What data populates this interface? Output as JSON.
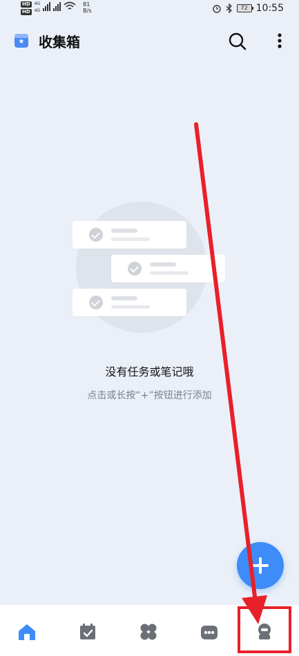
{
  "status_bar": {
    "hd1": "HD",
    "hd2": "HD",
    "net1": "4G",
    "net2": "4G",
    "speed_value": "81",
    "speed_unit": "B/s",
    "battery": "72",
    "time": "10:55"
  },
  "header": {
    "title": "收集箱",
    "title_icon": "inbox-star-icon",
    "search_icon": "search-icon",
    "more_icon": "more-vertical-icon"
  },
  "empty_state": {
    "title": "没有任务或笔记哦",
    "hint": "点击或长按“+”按钮进行添加"
  },
  "fab": {
    "icon": "plus-icon"
  },
  "bottom_nav": {
    "items": [
      {
        "icon": "home-icon",
        "active": true
      },
      {
        "icon": "calendar-check-icon",
        "active": false
      },
      {
        "icon": "grid-clover-icon",
        "active": false
      },
      {
        "icon": "robot-icon",
        "active": false
      },
      {
        "icon": "profile-icon",
        "active": false
      }
    ]
  },
  "colors": {
    "background": "#ebf0f8",
    "accent": "#3d8cf7",
    "annotation": "#e8202a"
  }
}
